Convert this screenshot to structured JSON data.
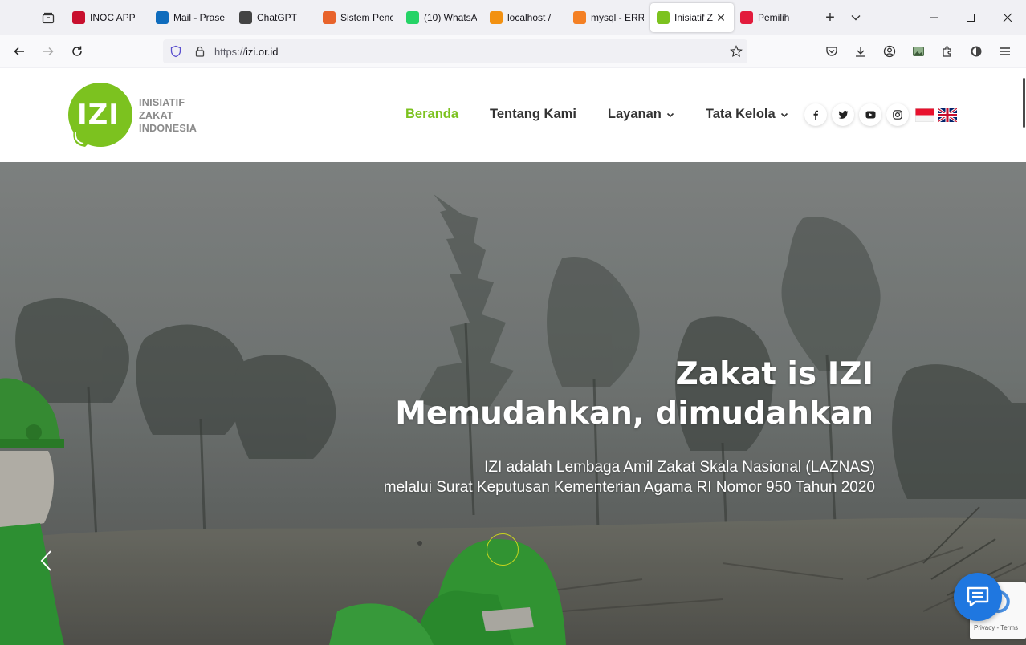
{
  "browser": {
    "tabs": [
      {
        "title": "INOC APP",
        "icon_color": "#c8102e",
        "active": false
      },
      {
        "title": "Mail - Prase",
        "icon_color": "#0f6cbd",
        "active": false
      },
      {
        "title": "ChatGPT",
        "icon_color": "#444444",
        "active": false
      },
      {
        "title": "Sistem Penc",
        "icon_color": "#e8632b",
        "active": false
      },
      {
        "title": "(10) WhatsA",
        "icon_color": "#25d366",
        "active": false
      },
      {
        "title": "localhost /",
        "icon_color": "#f29111",
        "active": false
      },
      {
        "title": "mysql - ERR",
        "icon_color": "#f48024",
        "active": false
      },
      {
        "title": "Inisiatif Z",
        "icon_color": "#7cc21f",
        "active": true
      },
      {
        "title": "Pemilih",
        "icon_color": "#e21b3c",
        "active": false
      }
    ],
    "url_prefix": "https://",
    "url_host": "izi.or.id"
  },
  "site": {
    "logo": {
      "mark": "IZI",
      "line1": "INISIATIF",
      "line2": "ZAKAT",
      "line3": "INDONESIA"
    },
    "nav": {
      "home": "Beranda",
      "about": "Tentang Kami",
      "services": "Layanan",
      "governance": "Tata Kelola"
    },
    "socials": [
      "facebook-icon",
      "twitter-icon",
      "youtube-icon",
      "instagram-icon"
    ],
    "flags": [
      "indonesia-flag",
      "uk-flag"
    ],
    "accent": "#7cc21f"
  },
  "hero": {
    "title_line1": "Zakat is IZI",
    "title_line2": "Memudahkan, dimudahkan",
    "sub_line1": "IZI adalah Lembaga Amil Zakat Skala Nasional (LAZNAS)",
    "sub_line2": "melalui Surat Keputusan Kementerian Agama RI Nomor 950 Tahun 2020"
  },
  "recaptcha": {
    "privacy": "Privacy",
    "separator": " - ",
    "terms": "Terms"
  }
}
